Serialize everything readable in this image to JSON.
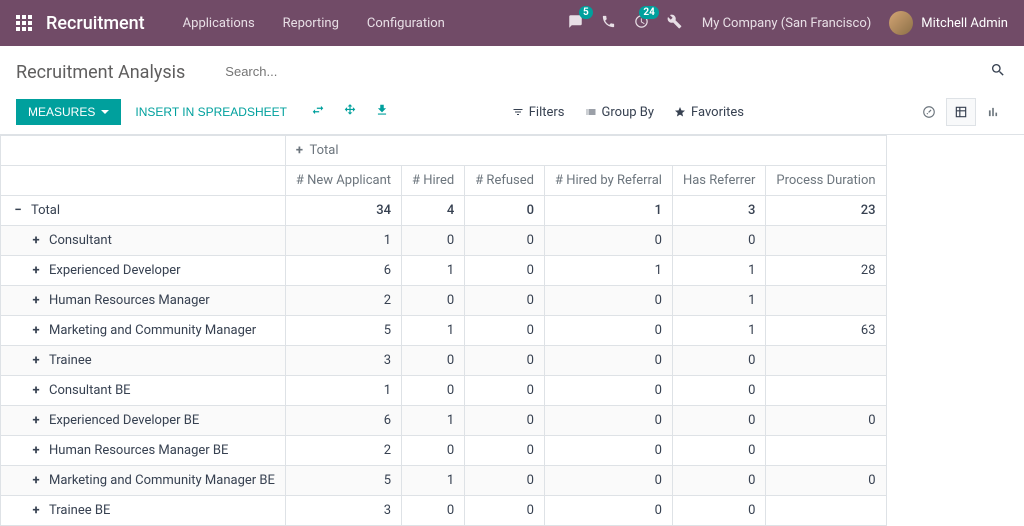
{
  "navbar": {
    "brand": "Recruitment",
    "menu": [
      "Applications",
      "Reporting",
      "Configuration"
    ],
    "messaging_badge": "5",
    "activities_badge": "24",
    "company": "My Company (San Francisco)",
    "user": "Mitchell Admin"
  },
  "breadcrumb": "Recruitment Analysis",
  "search": {
    "placeholder": "Search..."
  },
  "buttons": {
    "measures": "MEASURES",
    "insert": "INSERT IN SPREADSHEET"
  },
  "search_options": {
    "filters": "Filters",
    "group_by": "Group By",
    "favorites": "Favorites"
  },
  "pivot": {
    "col_header": "Total",
    "measures": [
      "# New Applicant",
      "# Hired",
      "# Refused",
      "# Hired by Referral",
      "Has Referrer",
      "Process Duration"
    ],
    "rows": [
      {
        "label": "Total",
        "expanded": true,
        "indent": 0,
        "values": [
          "34",
          "4",
          "0",
          "1",
          "3",
          "23"
        ]
      },
      {
        "label": "Consultant",
        "expanded": false,
        "indent": 1,
        "values": [
          "1",
          "0",
          "0",
          "0",
          "0",
          ""
        ]
      },
      {
        "label": "Experienced Developer",
        "expanded": false,
        "indent": 1,
        "values": [
          "6",
          "1",
          "0",
          "1",
          "1",
          "28"
        ]
      },
      {
        "label": "Human Resources Manager",
        "expanded": false,
        "indent": 1,
        "values": [
          "2",
          "0",
          "0",
          "0",
          "1",
          ""
        ]
      },
      {
        "label": "Marketing and Community Manager",
        "expanded": false,
        "indent": 1,
        "values": [
          "5",
          "1",
          "0",
          "0",
          "1",
          "63"
        ]
      },
      {
        "label": "Trainee",
        "expanded": false,
        "indent": 1,
        "values": [
          "3",
          "0",
          "0",
          "0",
          "0",
          ""
        ]
      },
      {
        "label": "Consultant BE",
        "expanded": false,
        "indent": 1,
        "values": [
          "1",
          "0",
          "0",
          "0",
          "0",
          ""
        ]
      },
      {
        "label": "Experienced Developer BE",
        "expanded": false,
        "indent": 1,
        "values": [
          "6",
          "1",
          "0",
          "0",
          "0",
          "0"
        ]
      },
      {
        "label": "Human Resources Manager BE",
        "expanded": false,
        "indent": 1,
        "values": [
          "2",
          "0",
          "0",
          "0",
          "0",
          ""
        ]
      },
      {
        "label": "Marketing and Community Manager BE",
        "expanded": false,
        "indent": 1,
        "values": [
          "5",
          "1",
          "0",
          "0",
          "0",
          "0"
        ]
      },
      {
        "label": "Trainee BE",
        "expanded": false,
        "indent": 1,
        "values": [
          "3",
          "0",
          "0",
          "0",
          "0",
          ""
        ]
      }
    ]
  }
}
